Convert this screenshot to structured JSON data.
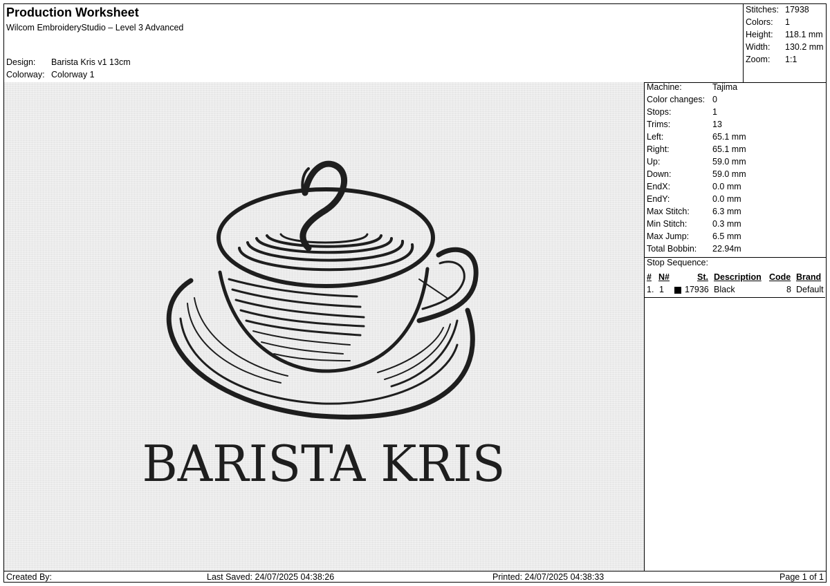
{
  "header": {
    "title": "Production Worksheet",
    "subtitle": "Wilcom EmbroideryStudio – Level 3 Advanced",
    "design_label": "Design:",
    "design_value": "Barista Kris v1 13cm",
    "colorway_label": "Colorway:",
    "colorway_value": "Colorway 1"
  },
  "stats": [
    {
      "label": "Stitches:",
      "value": "17938"
    },
    {
      "label": "Colors:",
      "value": "1"
    },
    {
      "label": "Height:",
      "value": "118.1 mm"
    },
    {
      "label": "Width:",
      "value": "130.2 mm"
    },
    {
      "label": "Zoom:",
      "value": "1:1"
    }
  ],
  "machine_info": [
    {
      "label": "Machine:",
      "value": "Tajima"
    },
    {
      "label": "Color changes:",
      "value": "0"
    },
    {
      "label": "Stops:",
      "value": "1"
    },
    {
      "label": "Trims:",
      "value": "13"
    },
    {
      "label": "Left:",
      "value": "65.1 mm"
    },
    {
      "label": "Right:",
      "value": "65.1 mm"
    },
    {
      "label": "Up:",
      "value": "59.0 mm"
    },
    {
      "label": "Down:",
      "value": "59.0 mm"
    },
    {
      "label": "EndX:",
      "value": "0.0 mm"
    },
    {
      "label": "EndY:",
      "value": "0.0 mm"
    },
    {
      "label": "Max Stitch:",
      "value": "6.3 mm"
    },
    {
      "label": "Min Stitch:",
      "value": "0.3 mm"
    },
    {
      "label": "Max Jump:",
      "value": "6.5 mm"
    },
    {
      "label": "Total Bobbin:",
      "value": "22.94m"
    }
  ],
  "stop_sequence": {
    "title": "Stop Sequence:",
    "headers": {
      "index": "#",
      "needle": "N#",
      "stitches": "St.",
      "description": "Description",
      "code": "Code",
      "brand": "Brand"
    },
    "rows": [
      {
        "index": "1.",
        "needle": "1",
        "color": "#000000",
        "stitches": "17936",
        "description": "Black",
        "code": "8",
        "brand": "Default"
      }
    ]
  },
  "design": {
    "text": "BARISTA KRIS",
    "thread_color": "#1e1e1e"
  },
  "footer": {
    "created_by": "Created By:",
    "last_saved": "Last Saved: 24/07/2025 04:38:26",
    "printed": "Printed: 24/07/2025 04:38:33",
    "page": "Page 1 of 1"
  }
}
